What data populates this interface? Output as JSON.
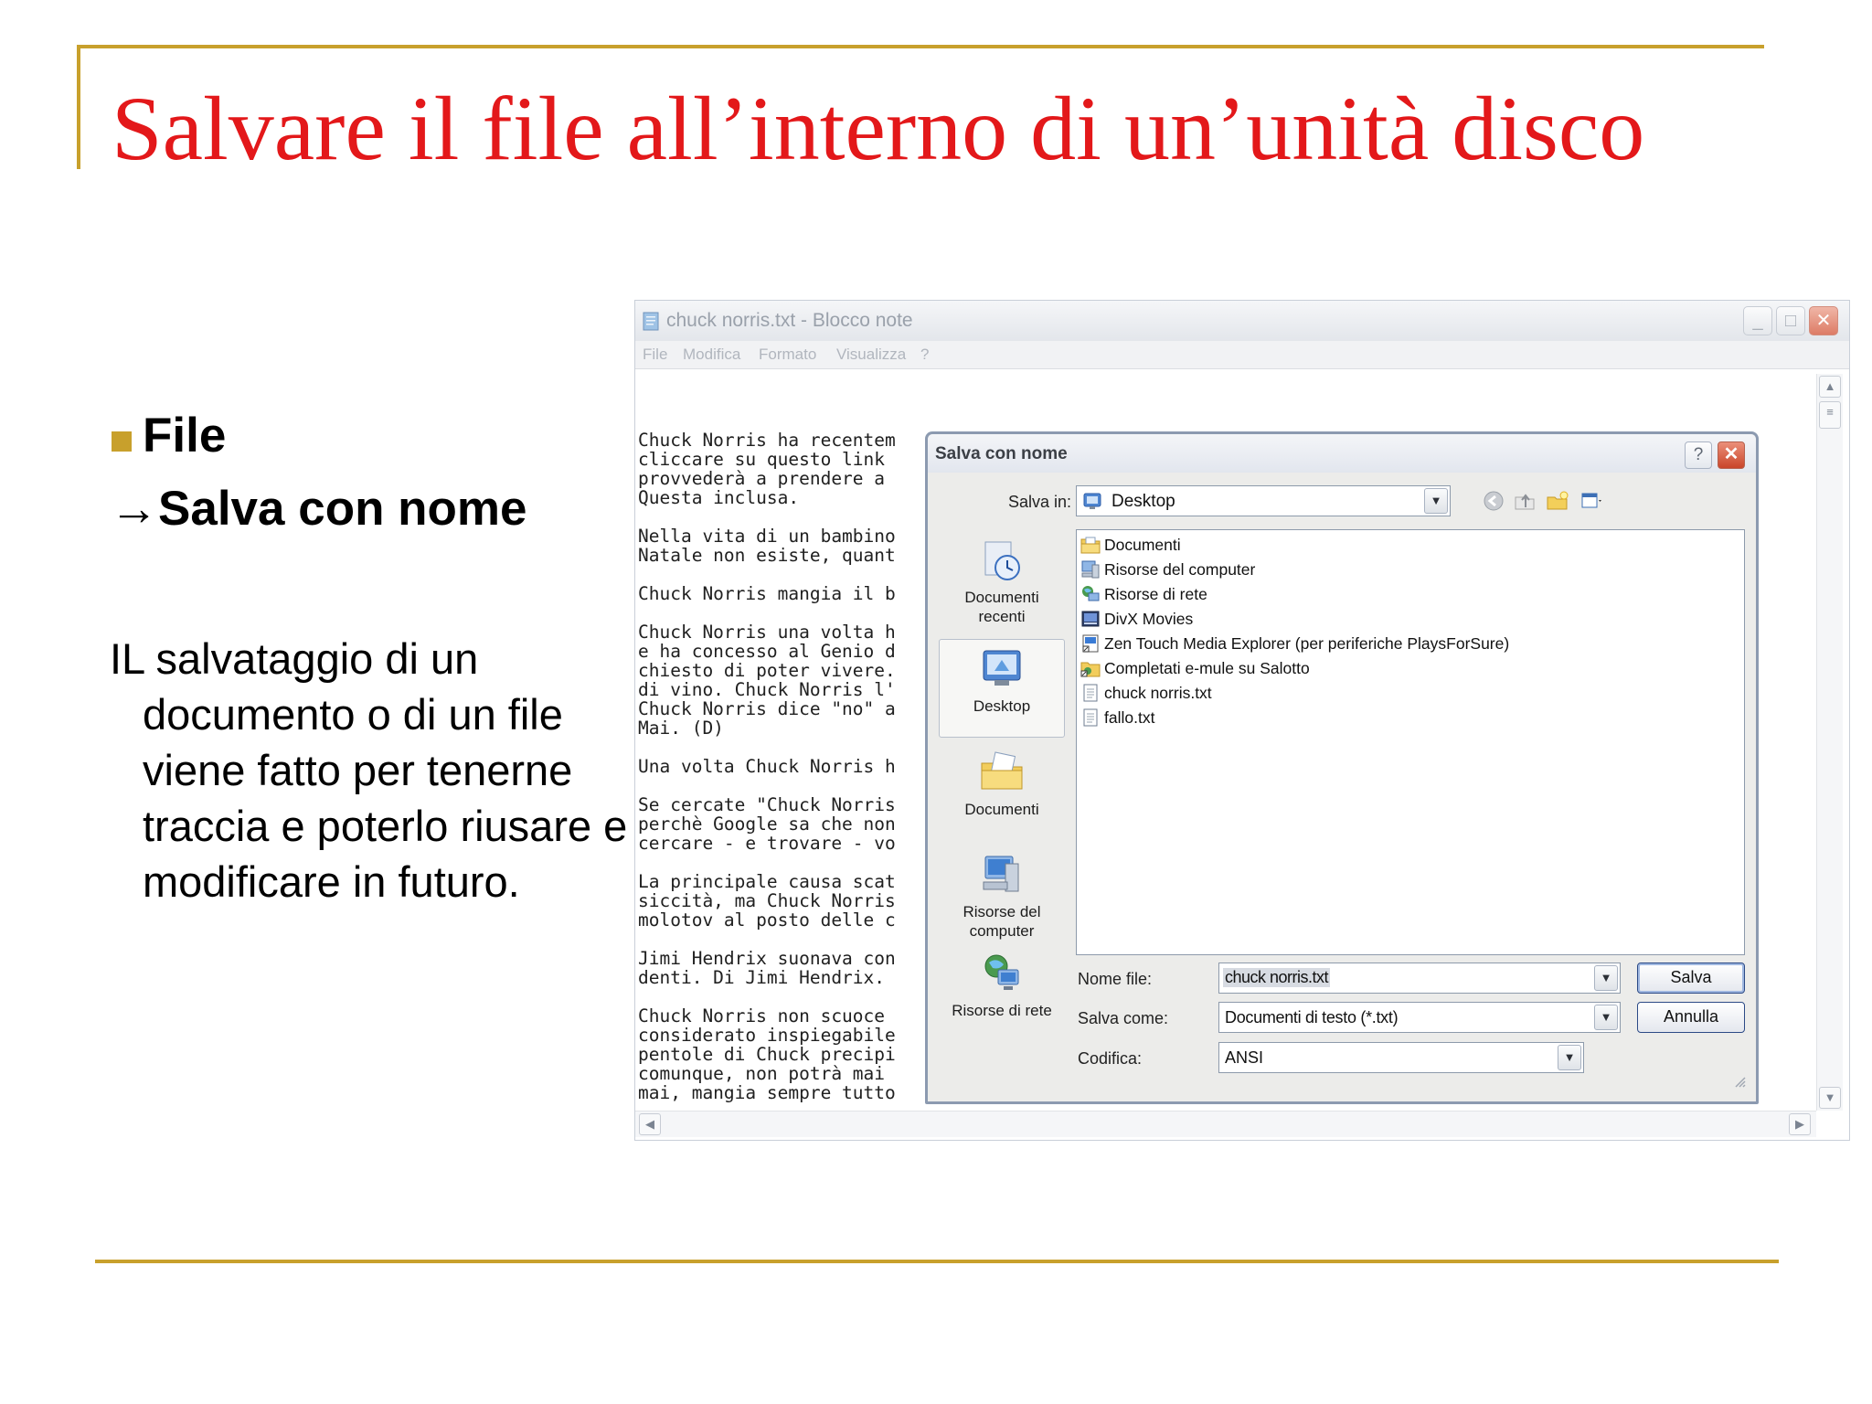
{
  "slide": {
    "title": "Salvare il file all’interno di un’unità disco",
    "bullet_file": "File",
    "bullet_salva": "→Salva con nome",
    "paragraph": "IL salvataggio di un documento o di un file viene fatto per tenerne traccia e poterlo riusare e modificare in futuro."
  },
  "notepad": {
    "title": "chuck norris.txt - Blocco note",
    "menu": [
      "File",
      "Modifica",
      "Formato",
      "Visualizza",
      "?"
    ],
    "text": "Chuck Norris ha recentem\ncliccare su questo link\nprovvederà a prendere a\nQuesta inclusa.\n\nNella vita di un bambino\nNatale non esiste, quant\n\nChuck Norris mangia il b\n\nChuck Norris una volta h\ne ha concesso al Genio d\nchiesto di poter vivere.\ndi vino. Chuck Norris l'\nChuck Norris dice \"no\" a\nMai. (D)\n\nUna volta Chuck Norris h\n\nSe cercate \"Chuck Norris\nperchè Google sa che non\ncercare - e trovare - vo\n\nLa principale causa scat\nsiccità, ma Chuck Norris\nmolotov al posto delle c\n\nJimi Hendrix suonava con\ndenti. Di Jimi Hendrix.\n\nChuck Norris non scuoce \nconsiderato inspiegabile\npentole di Chuck precipi\ncomunque, non potrà mai\nmai, mangia sempre tutto"
  },
  "dialog": {
    "title": "Salva con nome",
    "help": "?",
    "save_in_label": "Salva in:",
    "save_in_value": "Desktop",
    "places": [
      {
        "line1": "Documenti",
        "line2": "recenti",
        "icon": "recent-documents-icon"
      },
      {
        "line1": "Desktop",
        "line2": "",
        "icon": "desktop-icon"
      },
      {
        "line1": "Documenti",
        "line2": "",
        "icon": "my-documents-icon"
      },
      {
        "line1": "Risorse del",
        "line2": "computer",
        "icon": "my-computer-icon"
      },
      {
        "line1": "Risorse di rete",
        "line2": "",
        "icon": "network-icon"
      }
    ],
    "files": [
      {
        "name": "Documenti",
        "icon": "documents-folder-icon"
      },
      {
        "name": "Risorse del computer",
        "icon": "computer-icon"
      },
      {
        "name": "Risorse di rete",
        "icon": "network-places-icon"
      },
      {
        "name": "DivX Movies",
        "icon": "divx-icon"
      },
      {
        "name": "Zen Touch Media Explorer (per periferiche PlaysForSure)",
        "icon": "media-explorer-icon"
      },
      {
        "name": "Completati e-mule su Salotto",
        "icon": "shortcut-folder-icon"
      },
      {
        "name": "chuck norris.txt",
        "icon": "text-file-icon"
      },
      {
        "name": "fallo.txt",
        "icon": "text-file-icon"
      }
    ],
    "filename_label": "Nome file:",
    "filename_value": "chuck norris.txt",
    "type_label": "Salva come:",
    "type_value": "Documenti di testo (*.txt)",
    "encoding_label": "Codifica:",
    "encoding_value": "ANSI",
    "save_button": "Salva",
    "cancel_button": "Annulla"
  },
  "colors": {
    "title_red": "#e3181a",
    "rule_gold": "#c8a02c",
    "dialog_border": "#8c9ab0"
  }
}
